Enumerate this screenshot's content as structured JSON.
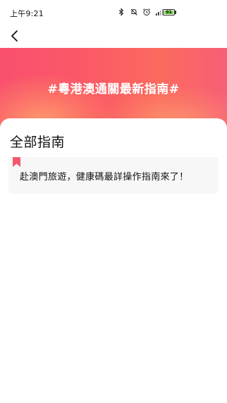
{
  "status_bar": {
    "time": "上午9:21",
    "icons": [
      "bluetooth-icon",
      "mute-icon",
      "alarm-icon",
      "signal-icon",
      "wifi-icon"
    ],
    "battery_level": "91",
    "battery_color": "#6fd13a"
  },
  "nav": {
    "back_icon": "chevron-left-icon"
  },
  "banner": {
    "title": "#粵港澳通關最新指南#",
    "colors": {
      "start": "#f9506e",
      "end": "#f75f76",
      "glow": "#ffaa6e"
    }
  },
  "main": {
    "section_title": "全部指南",
    "guides": [
      {
        "title": "赴澳門旅遊，健康碼最詳操作指南來了！",
        "icon": "bookmark-icon",
        "icon_color": "#f2596b"
      }
    ]
  }
}
